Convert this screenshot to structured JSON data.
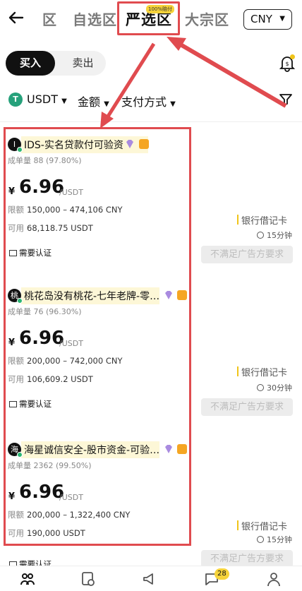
{
  "header": {
    "back_icon": "arrow-left-icon",
    "tabs": [
      {
        "label": "区"
      },
      {
        "label": "自选区"
      },
      {
        "label": "严选区"
      },
      {
        "label": "大宗区"
      }
    ],
    "strict_badge": "100%赔付",
    "currency": "CNY"
  },
  "trade_toggle": {
    "buy": "买入",
    "sell": "卖出"
  },
  "filters": {
    "coin": "USDT",
    "amount": "金额",
    "payment": "支付方式",
    "coin_icon": "T"
  },
  "ads": [
    {
      "avatar": "I",
      "name": "IDS-实名贷款付可验资",
      "stats": "成单量 88 (97.80%)",
      "currency_symbol": "¥",
      "price": "6.96",
      "unit": "/USDT",
      "limit_label": "限额",
      "limit": "150,000 – 474,106 CNY",
      "avail_label": "可用",
      "avail": "68,118.75 USDT",
      "verify": "需要认证",
      "payment": "银行借记卡",
      "time": "15分钟",
      "action": "不满足广告方要求"
    },
    {
      "avatar": "桃",
      "name": "桃花岛没有桃花-七年老牌-零…",
      "stats": "成单量 76 (96.30%)",
      "currency_symbol": "¥",
      "price": "6.96",
      "unit": "/USDT",
      "limit_label": "限额",
      "limit": "200,000 – 742,000 CNY",
      "avail_label": "可用",
      "avail": "106,609.2 USDT",
      "verify": "需要认证",
      "payment": "银行借记卡",
      "time": "30分钟",
      "action": "不满足广告方要求"
    },
    {
      "avatar": "海",
      "name": "海星诚信安全-股市资金-可验…",
      "stats": "成单量 2362 (99.50%)",
      "currency_symbol": "¥",
      "price": "6.96",
      "unit": "/USDT",
      "limit_label": "限额",
      "limit": "200,000 – 1,322,400 CNY",
      "avail_label": "可用",
      "avail": "190,000 USDT",
      "verify": "需要认证",
      "payment": "银行借记卡",
      "time": "15分钟",
      "action": "不满足广告方要求"
    }
  ],
  "bottom_nav": {
    "items": [
      "p2p-icon",
      "orders-icon",
      "ads-icon",
      "chat-icon",
      "profile-icon"
    ],
    "chat_badge": "28"
  },
  "colors": {
    "accent": "#f6d33a",
    "annotation": "#e04b4f",
    "online": "#2bb673"
  }
}
